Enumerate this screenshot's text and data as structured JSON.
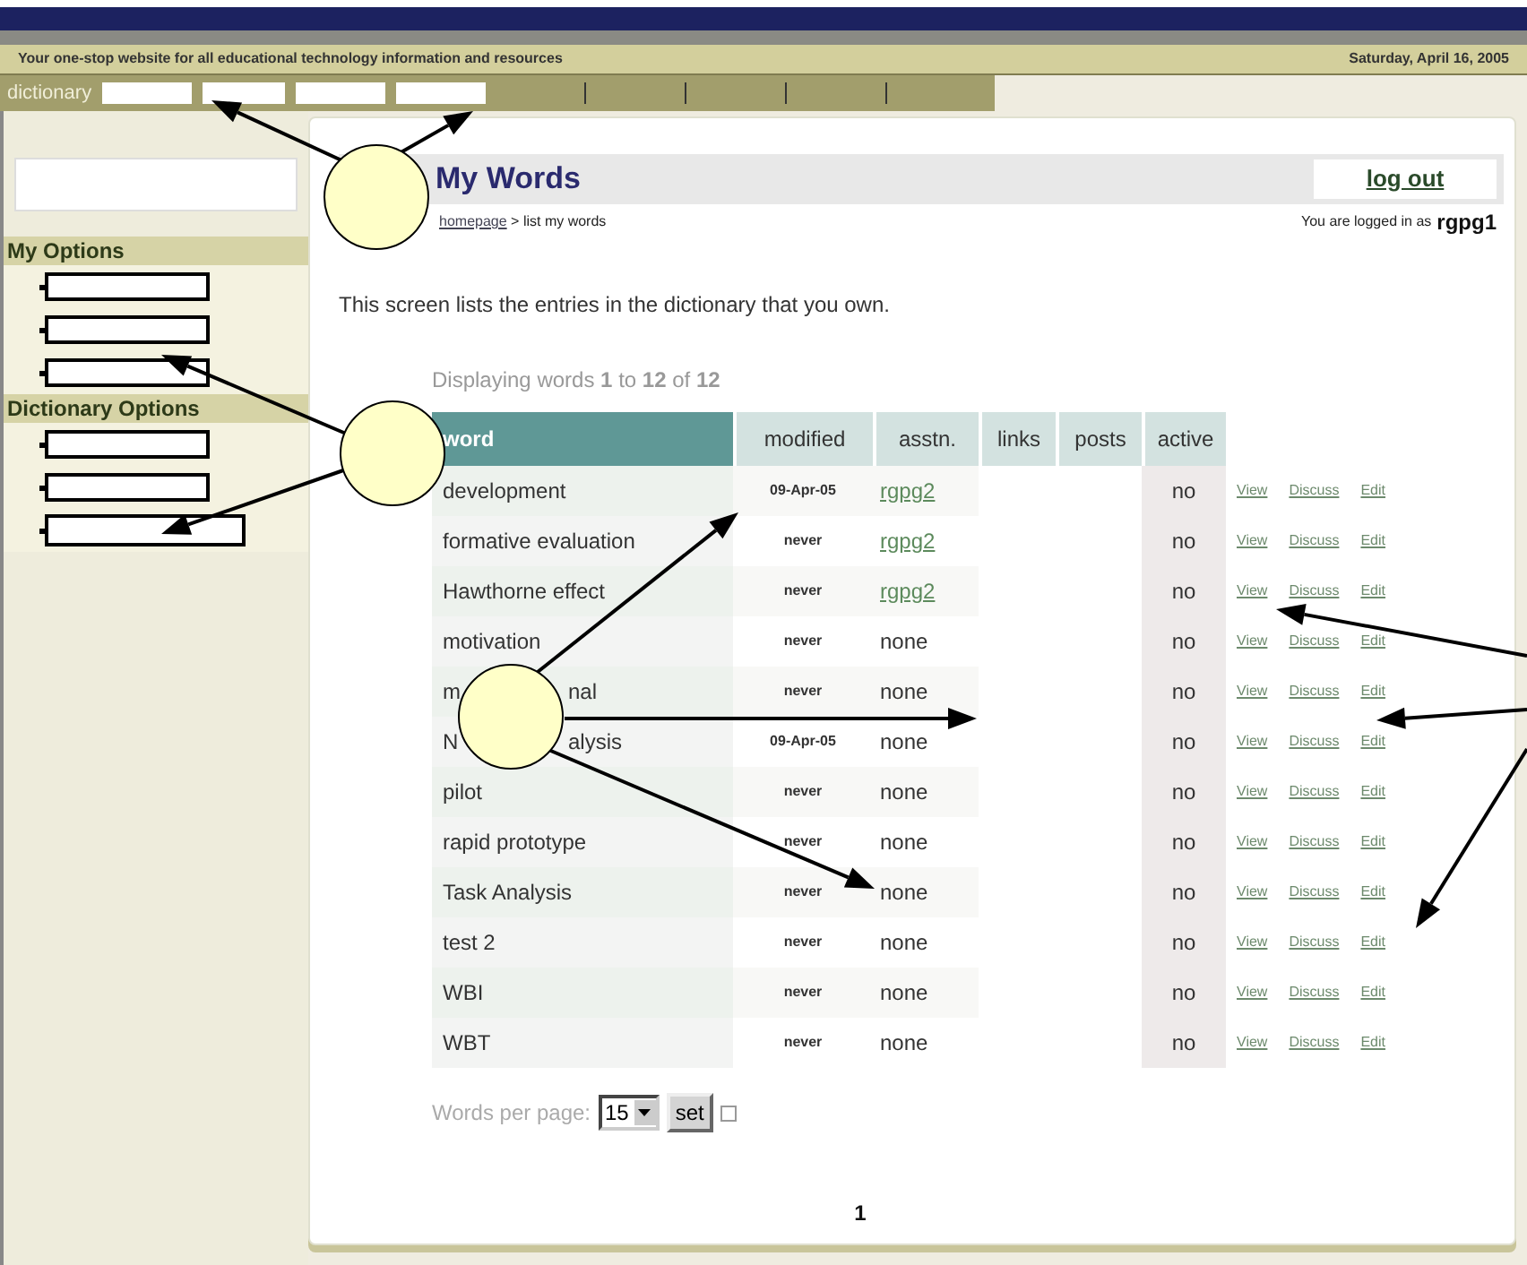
{
  "header": {
    "tagline": "Your one-stop website for all educational technology information and resources",
    "date": "Saturday, April 16, 2005"
  },
  "nav": {
    "label": "dictionary"
  },
  "sidebar": {
    "sections": [
      {
        "title": "My Options",
        "items": [
          {
            "kind": "blank"
          },
          {
            "kind": "blank"
          },
          {
            "kind": "blank"
          }
        ]
      },
      {
        "title": "Dictionary Options",
        "items": [
          {
            "kind": "blank"
          },
          {
            "kind": "blank"
          },
          {
            "kind": "wide"
          }
        ]
      }
    ]
  },
  "page": {
    "title": "My Words",
    "logout": "log out",
    "breadcrumb_link": "homepage",
    "breadcrumb_rest": "> list my words",
    "login_label": "You are logged in as",
    "user": "rgpg1",
    "intro": "This screen lists the entries in the dictionary that you own.",
    "displaying": "Displaying words **1** to **12** of **12**"
  },
  "table": {
    "columns": [
      "word",
      "modified",
      "asstn.",
      "links",
      "posts",
      "active"
    ],
    "rows": [
      {
        "word": "development",
        "modified": "09-Apr-05",
        "asstn": "rgpg2",
        "assigned_link": true,
        "active": "no",
        "actions": [
          "View",
          "Discuss",
          "Edit"
        ]
      },
      {
        "word": "formative evaluation",
        "modified": "never",
        "asstn": "rgpg2",
        "assigned_link": true,
        "active": "no",
        "actions": [
          "View",
          "Discuss",
          "Edit"
        ]
      },
      {
        "word": "Hawthorne effect",
        "modified": "never",
        "asstn": "rgpg2",
        "assigned_link": true,
        "active": "no",
        "actions": [
          "View",
          "Discuss",
          "Edit"
        ]
      },
      {
        "word": "motivation",
        "modified": "never",
        "asstn": "none",
        "assigned_link": false,
        "active": "no",
        "actions": [
          "View",
          "Discuss",
          "Edit"
        ]
      },
      {
        "word": "m",
        "word_tail": "nal",
        "modified": "never",
        "asstn": "none",
        "assigned_link": false,
        "active": "no",
        "actions": [
          "View",
          "Discuss",
          "Edit"
        ]
      },
      {
        "word": "N",
        "word_tail": "alysis",
        "modified": "09-Apr-05",
        "asstn": "none",
        "assigned_link": false,
        "active": "no",
        "actions": [
          "View",
          "Discuss",
          "Edit"
        ]
      },
      {
        "word": "pilot",
        "modified": "never",
        "asstn": "none",
        "assigned_link": false,
        "active": "no",
        "actions": [
          "View",
          "Discuss",
          "Edit"
        ]
      },
      {
        "word": "rapid prototype",
        "modified": "never",
        "asstn": "none",
        "assigned_link": false,
        "active": "no",
        "actions": [
          "View",
          "Discuss",
          "Edit"
        ]
      },
      {
        "word": "Task Analysis",
        "modified": "never",
        "asstn": "none",
        "assigned_link": false,
        "active": "no",
        "actions": [
          "View",
          "Discuss",
          "Edit"
        ]
      },
      {
        "word": "test 2",
        "modified": "never",
        "asstn": "none",
        "assigned_link": false,
        "active": "no",
        "actions": [
          "View",
          "Discuss",
          "Edit"
        ]
      },
      {
        "word": "WBI",
        "modified": "never",
        "asstn": "none",
        "assigned_link": false,
        "active": "no",
        "actions": [
          "View",
          "Discuss",
          "Edit"
        ]
      },
      {
        "word": "WBT",
        "modified": "never",
        "asstn": "none",
        "assigned_link": false,
        "active": "no",
        "actions": [
          "View",
          "Discuss",
          "Edit"
        ]
      }
    ]
  },
  "footer": {
    "per_page_label": "Words per page:",
    "per_page_value": "15",
    "set_button": "set",
    "checkbox_checked": false,
    "page_number": "1"
  }
}
